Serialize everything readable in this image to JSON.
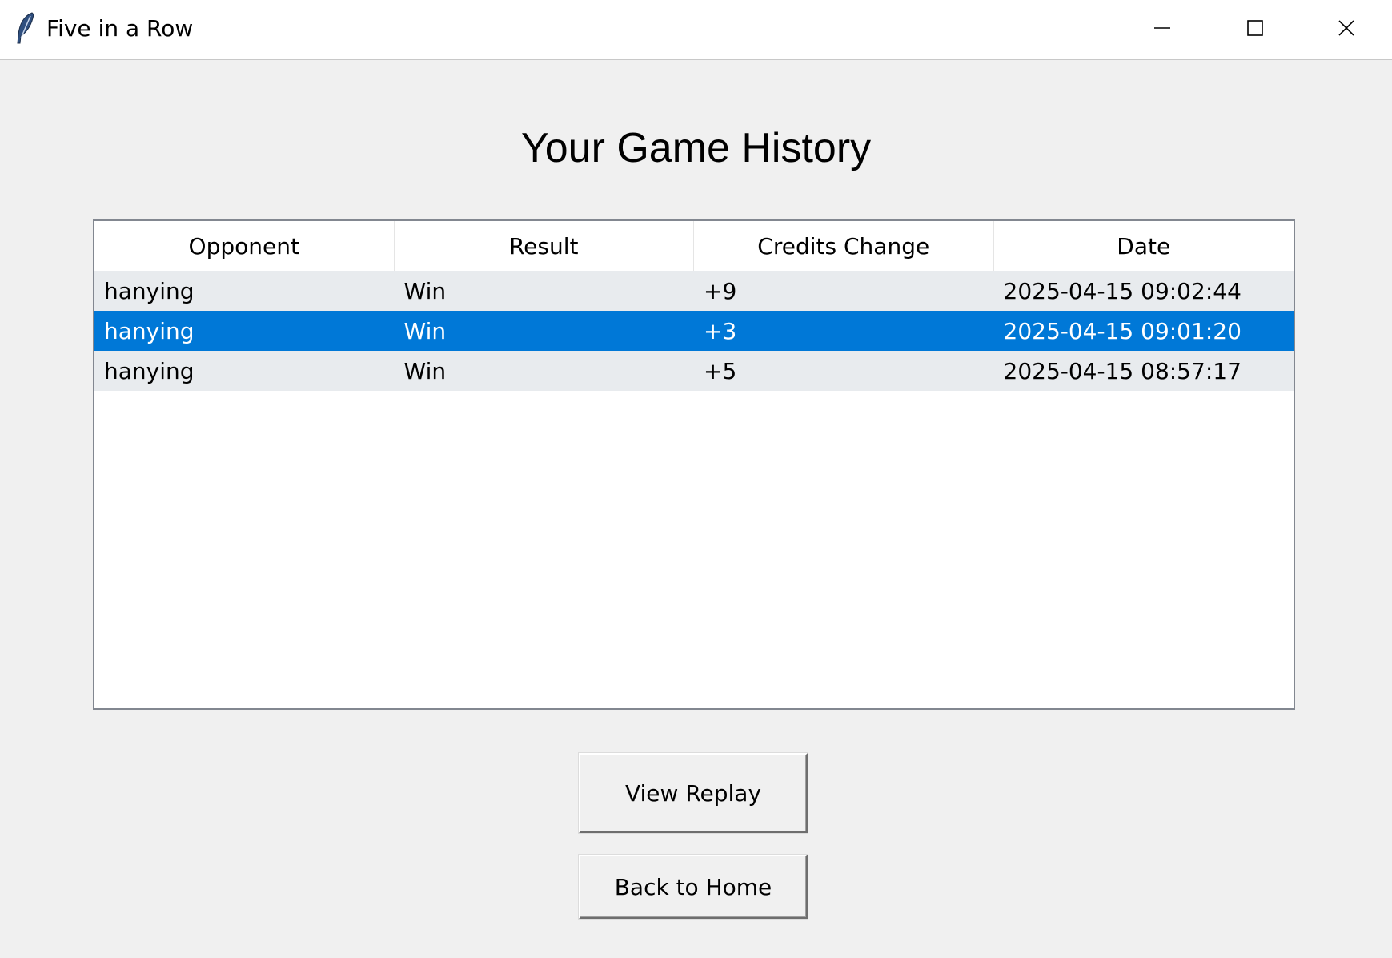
{
  "window": {
    "title": "Five in a Row"
  },
  "page": {
    "title": "Your Game History"
  },
  "table": {
    "columns": [
      "Opponent",
      "Result",
      "Credits Change",
      "Date"
    ],
    "rows": [
      {
        "opponent": "hanying",
        "result": "Win",
        "credits_change": "+9",
        "date": "2025-04-15 09:02:44",
        "selected": false
      },
      {
        "opponent": "hanying",
        "result": "Win",
        "credits_change": "+3",
        "date": "2025-04-15 09:01:20",
        "selected": true
      },
      {
        "opponent": "hanying",
        "result": "Win",
        "credits_change": "+5",
        "date": "2025-04-15 08:57:17",
        "selected": false
      }
    ]
  },
  "buttons": {
    "view_replay": "View Replay",
    "back_home": "Back to Home"
  },
  "icons": {
    "app": "feather-icon",
    "minimize": "minimize-icon",
    "maximize": "maximize-icon",
    "close": "close-icon"
  },
  "colors": {
    "selection": "#0078d7",
    "row_background": "#e8ebee",
    "window_background": "#f0f0f0"
  }
}
